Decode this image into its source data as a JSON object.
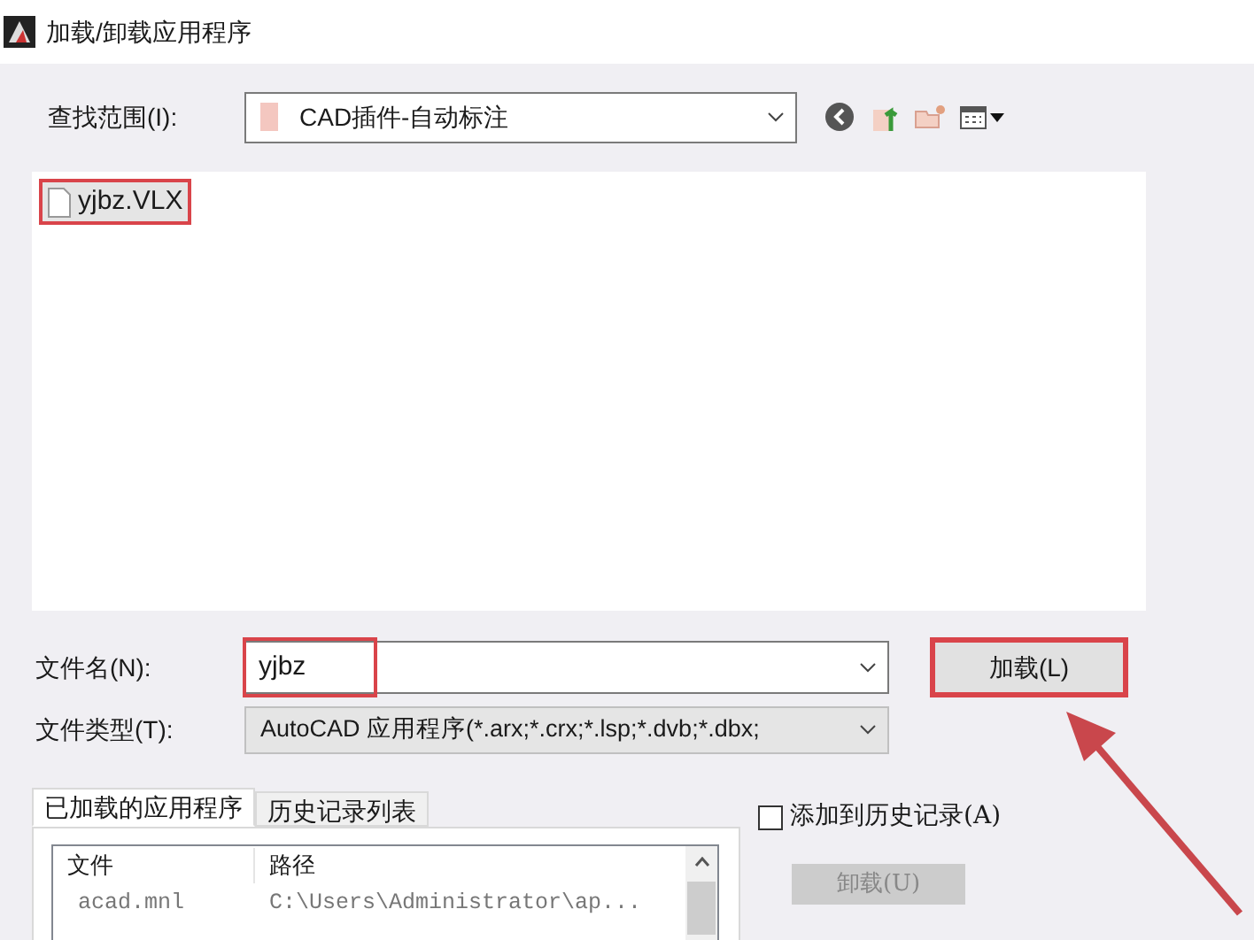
{
  "window": {
    "title": "加载/卸载应用程序"
  },
  "look_in": {
    "label": "查找范围(I):",
    "value": "CAD插件-自动标注"
  },
  "files": [
    {
      "name": "yjbz.VLX",
      "selected": true,
      "highlighted": true
    }
  ],
  "file_name": {
    "label": "文件名(N):",
    "value": "yjbz",
    "highlighted": true
  },
  "load_button": {
    "label": "加载(L)",
    "highlighted": true
  },
  "file_type": {
    "label": "文件类型(T):",
    "value": "AutoCAD 应用程序(*.arx;*.crx;*.lsp;*.dvb;*.dbx;"
  },
  "tabs": [
    {
      "label": "已加载的应用程序",
      "selected": true
    },
    {
      "label": "历史记录列表",
      "selected": false
    }
  ],
  "table": {
    "columns": [
      "文件",
      "路径"
    ],
    "rows": [
      [
        "acad.mnl",
        "C:\\Users\\Administrator\\ap..."
      ]
    ]
  },
  "history_checkbox": {
    "label": "添加到历史记录(A)",
    "checked": false
  },
  "unload_button": {
    "label": "卸载(U)",
    "disabled": true
  }
}
